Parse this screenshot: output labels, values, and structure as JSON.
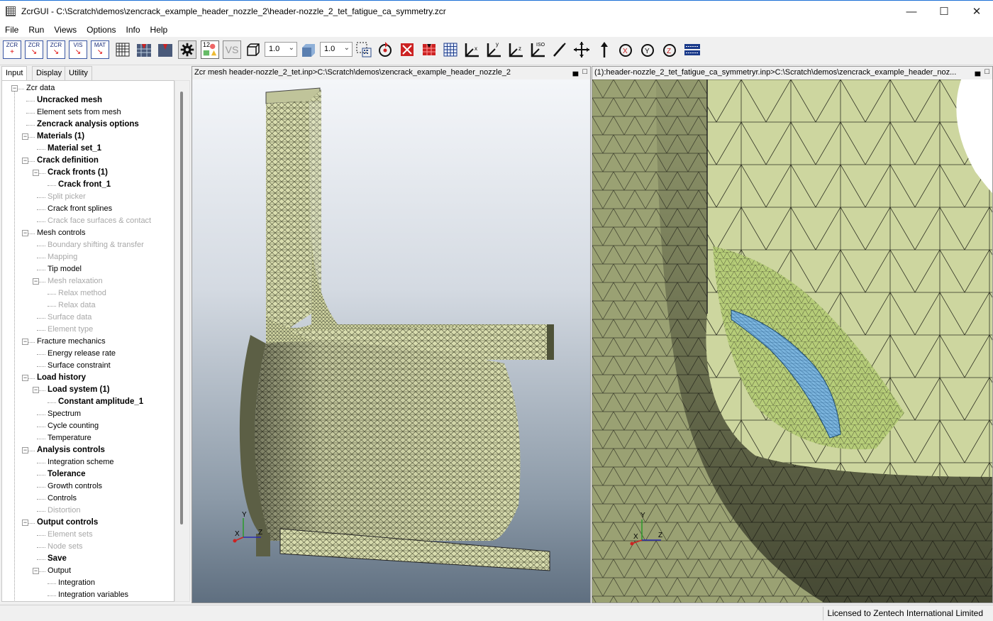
{
  "window": {
    "title": "ZcrGUI - C:\\Scratch\\demos\\zencrack_example_header_nozzle_2\\header-nozzle_2_tet_fatigue_ca_symmetry.zcr",
    "minimize": "—",
    "maximize": "☐",
    "close": "✕"
  },
  "menu": [
    "File",
    "Run",
    "Views",
    "Options",
    "Info",
    "Help"
  ],
  "toolbar": {
    "zcr_new": "ZCR",
    "zcr_open": "ZCR",
    "zcr_run": "ZCR",
    "vis": "VIS",
    "mat": "MAT",
    "vs": "VS",
    "numbers": "12",
    "shrink_value": "1.0",
    "scale_value": "1.0"
  },
  "tabs": [
    "Input",
    "Display",
    "Utility"
  ],
  "tree": [
    {
      "label": "Zcr data",
      "style": "normal"
    },
    {
      "label": "Uncracked mesh",
      "style": "bold"
    },
    {
      "label": "Element sets from mesh",
      "style": "normal"
    },
    {
      "label": "Zencrack analysis options",
      "style": "bold"
    },
    {
      "label": "Materials (1)",
      "style": "bold"
    },
    {
      "label": "Material set_1",
      "style": "bold"
    },
    {
      "label": "Crack definition",
      "style": "bold"
    },
    {
      "label": "Crack fronts (1)",
      "style": "bold"
    },
    {
      "label": "Crack front_1",
      "style": "bold"
    },
    {
      "label": "Split picker",
      "style": "disabled"
    },
    {
      "label": "Crack front splines",
      "style": "normal"
    },
    {
      "label": "Crack face surfaces & contact",
      "style": "disabled"
    },
    {
      "label": "Mesh controls",
      "style": "normal"
    },
    {
      "label": "Boundary shifting & transfer",
      "style": "disabled"
    },
    {
      "label": "Mapping",
      "style": "disabled"
    },
    {
      "label": "Tip model",
      "style": "normal"
    },
    {
      "label": "Mesh relaxation",
      "style": "disabled"
    },
    {
      "label": "Relax method",
      "style": "disabled"
    },
    {
      "label": "Relax data",
      "style": "disabled"
    },
    {
      "label": "Surface data",
      "style": "disabled"
    },
    {
      "label": "Element type",
      "style": "disabled"
    },
    {
      "label": "Fracture mechanics",
      "style": "normal"
    },
    {
      "label": "Energy release rate",
      "style": "normal"
    },
    {
      "label": "Surface constraint",
      "style": "normal"
    },
    {
      "label": "Load history",
      "style": "bold"
    },
    {
      "label": "Load system (1)",
      "style": "bold"
    },
    {
      "label": "Constant amplitude_1",
      "style": "bold"
    },
    {
      "label": "Spectrum",
      "style": "normal"
    },
    {
      "label": "Cycle counting",
      "style": "normal"
    },
    {
      "label": "Temperature",
      "style": "normal"
    },
    {
      "label": "Analysis controls",
      "style": "bold"
    },
    {
      "label": "Integration scheme",
      "style": "normal"
    },
    {
      "label": "Tolerance",
      "style": "bold"
    },
    {
      "label": "Growth controls",
      "style": "normal"
    },
    {
      "label": "Controls",
      "style": "normal"
    },
    {
      "label": "Distortion",
      "style": "disabled"
    },
    {
      "label": "Output controls",
      "style": "bold"
    },
    {
      "label": "Element sets",
      "style": "disabled"
    },
    {
      "label": "Node sets",
      "style": "disabled"
    },
    {
      "label": "Save",
      "style": "bold"
    },
    {
      "label": "Output",
      "style": "normal"
    },
    {
      "label": "Integration",
      "style": "normal"
    },
    {
      "label": "Integration variables",
      "style": "normal"
    }
  ],
  "left_pane": {
    "header": "Zcr mesh header-nozzle_2_tet.inp>C:\\Scratch\\demos\\zencrack_example_header_nozzle_2",
    "axis_y": "Y",
    "axis_x": "X",
    "axis_z": "Z"
  },
  "right_pane": {
    "header": "(1):header-nozzle_2_tet_fatigue_ca_symmetryr.inp>C:\\Scratch\\demos\\zencrack_example_header_noz...",
    "axis_y": "Y",
    "axis_x": "X",
    "axis_z": "Z"
  },
  "pane_controls": {
    "minimize": "▄",
    "maximize": "□"
  },
  "status": {
    "license": "Licensed to Zentech International Limited"
  },
  "colors": {
    "mesh": "#d8dcae",
    "mesh_dark": "#5c5f45",
    "crack": "#7ab3dc",
    "refined": "#b8cc7c",
    "accent": "#1b6fd6"
  }
}
